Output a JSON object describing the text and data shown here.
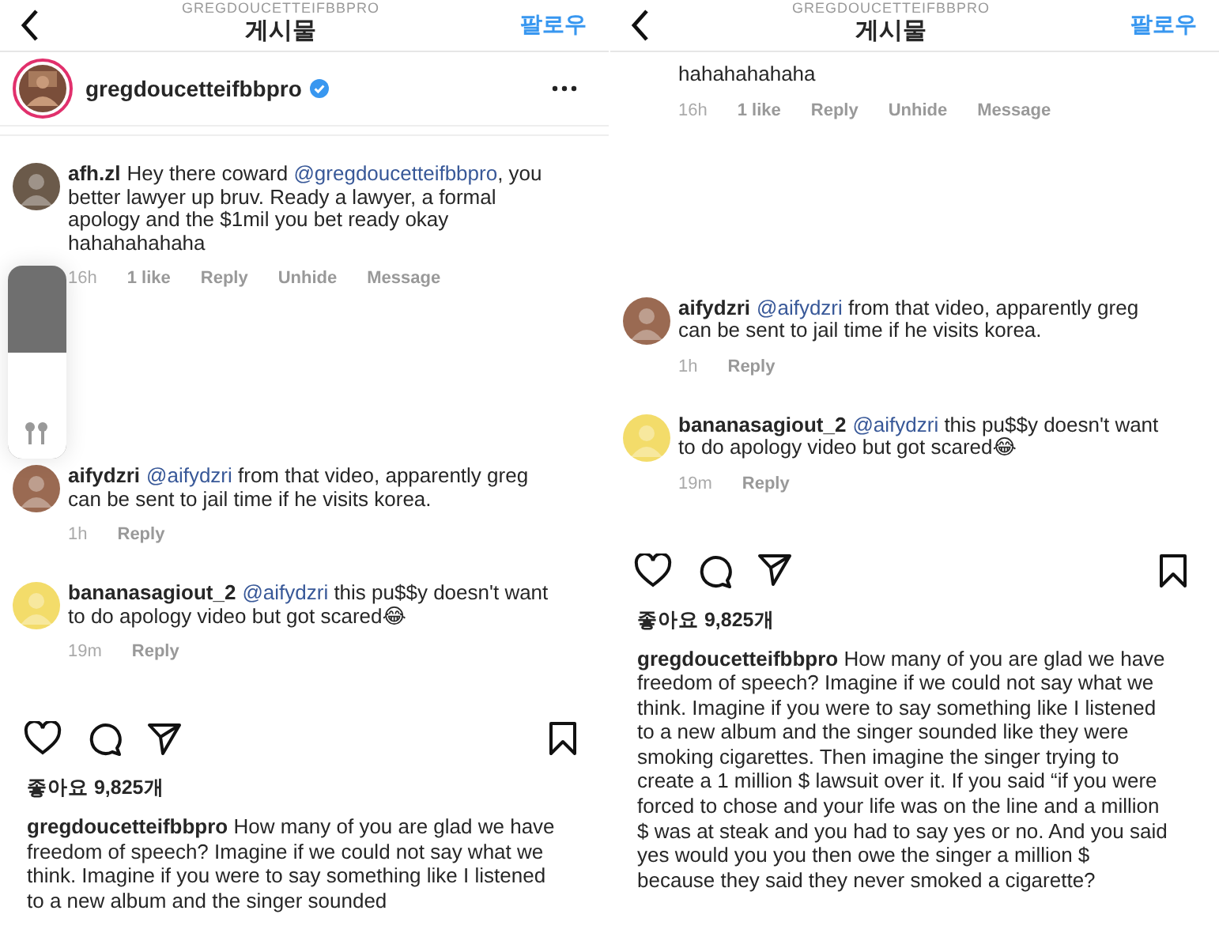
{
  "panels": [
    {
      "header": {
        "account": "GREGDOUCETTEIFBBPRO",
        "title": "게시물",
        "follow": "팔로우"
      },
      "author": {
        "username": "gregdoucetteifbbpro",
        "verified": true
      },
      "comments": [
        {
          "avatar": {
            "kind": "picture"
          },
          "username": "afh.zl",
          "parts": [
            {
              "kind": "text",
              "text": "Hey there coward "
            },
            {
              "kind": "mention",
              "text": "@gregdoucetteifbbpro"
            },
            {
              "kind": "text",
              "text": ", you better lawyer up bruv. Ready a lawyer, a formal apology and the $1mil you bet ready okay hahahahahaha"
            }
          ],
          "meta": [
            "16h",
            "1 like",
            "Reply",
            "Unhide",
            "Message"
          ]
        },
        {
          "avatar": {
            "kind": "picture"
          },
          "username": "aifydzri",
          "parts": [
            {
              "kind": "mention",
              "text": "@aifydzri"
            },
            {
              "kind": "text",
              "text": " from that video, apparently greg can be sent to jail time if he visits korea."
            }
          ],
          "meta": [
            "1h",
            "Reply"
          ]
        },
        {
          "avatar": {
            "kind": "picture"
          },
          "username": "bananasagiout_2",
          "parts": [
            {
              "kind": "mention",
              "text": "@aifydzri"
            },
            {
              "kind": "text",
              "text": " this pu$$y doesn't want to do apology video but got scared😂"
            }
          ],
          "meta": [
            "19m",
            "Reply"
          ]
        }
      ],
      "volume_hud": {
        "level": 0.55
      },
      "likes": "좋아요 9,825개",
      "caption": {
        "username": "gregdoucetteifbbpro",
        "text": "How many of you are glad we have freedom of speech? Imagine if we could not say what we think. Imagine if you were to say something like I listened to a new album and the singer sounded"
      }
    },
    {
      "header": {
        "account": "GREGDOUCETTEIFBBPRO",
        "title": "게시물",
        "follow": "팔로우"
      },
      "comments": [
        {
          "parts": [
            {
              "kind": "text",
              "text": "hahahahahaha"
            }
          ],
          "meta": [
            "16h",
            "1 like",
            "Reply",
            "Unhide",
            "Message"
          ]
        },
        {
          "avatar": {
            "kind": "picture"
          },
          "username": "aifydzri",
          "parts": [
            {
              "kind": "mention",
              "text": "@aifydzri"
            },
            {
              "kind": "text",
              "text": " from that video, apparently greg can be sent to jail time if he visits korea."
            }
          ],
          "meta": [
            "1h",
            "Reply"
          ]
        },
        {
          "avatar": {
            "kind": "picture"
          },
          "username": "bananasagiout_2",
          "parts": [
            {
              "kind": "mention",
              "text": "@aifydzri"
            },
            {
              "kind": "text",
              "text": " this pu$$y doesn't want to do apology video but got scared😂"
            }
          ],
          "meta": [
            "19m",
            "Reply"
          ]
        }
      ],
      "likes": "좋아요 9,825개",
      "caption": {
        "username": "gregdoucetteifbbpro",
        "text": "How many of you are glad we have freedom of speech? Imagine if we could not say what we think. Imagine if you were to say something like I listened to a new album and the singer sounded like they were smoking cigarettes. Then imagine the singer trying to create a 1 million $ lawsuit over it. If you said “if you were forced to chose and your life was on the line and a million $ was at steak and you had to say yes or no. And you said yes would you you then owe the singer a million $ because they said they never smoked a cigarette?"
      }
    }
  ]
}
